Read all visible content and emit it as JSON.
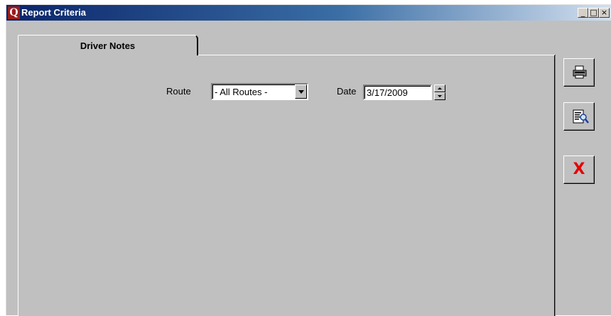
{
  "window": {
    "title": "Report Criteria",
    "logo_letter": "Q",
    "controls": {
      "minimize": "_",
      "maximize": "□",
      "close": "×"
    }
  },
  "tabs": [
    {
      "label": "Driver Notes",
      "active": true
    }
  ],
  "form": {
    "route": {
      "label": "Route",
      "value": "- All Routes -"
    },
    "date": {
      "label": "Date",
      "value": "3/17/2009"
    }
  },
  "toolbar": {
    "print": {
      "icon": "printer-icon"
    },
    "preview": {
      "icon": "preview-icon"
    },
    "cancel": {
      "icon": "close-icon",
      "glyph": "X",
      "color": "#e60000"
    }
  },
  "colors": {
    "title_gradient_start": "#0a246a",
    "title_gradient_end": "#d4e0f0",
    "face": "#c0c0c0",
    "logo_bg": "#9b1b1b"
  }
}
